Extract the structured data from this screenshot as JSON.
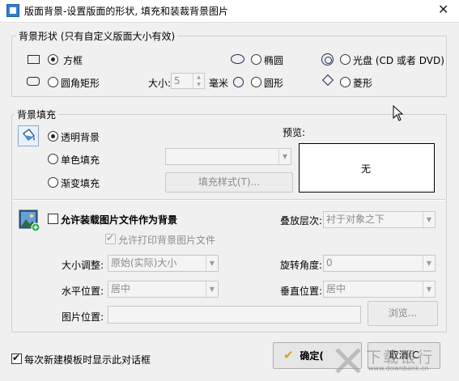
{
  "window": {
    "title": "版面背景-设置版面的形状, 填充和装裁背景图片",
    "close_glyph": "✕"
  },
  "shape_group": {
    "legend": "背景形状 (只有自定义版面大小有效)",
    "options": [
      {
        "label": "方框",
        "checked": true
      },
      {
        "label": "圆角矩形",
        "checked": false
      },
      {
        "label": "椭圆",
        "checked": false
      },
      {
        "label": "圆形",
        "checked": false
      },
      {
        "label": "光盘 (CD 或者 DVD)",
        "checked": false
      },
      {
        "label": "菱形",
        "checked": false
      }
    ],
    "size_label": "大小:",
    "size_value": "5",
    "size_unit": "毫米"
  },
  "fill_group": {
    "legend": "背景填充",
    "options": [
      {
        "label": "透明背景",
        "checked": true
      },
      {
        "label": "单色填充",
        "checked": false
      },
      {
        "label": "渐变填充",
        "checked": false
      }
    ],
    "color_value": "",
    "style_button": "填充样式(T)...",
    "preview_label": "预览:",
    "preview_text": "无"
  },
  "image_group": {
    "enable_label": "允许装载图片文件作为背景",
    "print_label": "允许打印背景图片文件",
    "layer_label": "叠放层次:",
    "layer_value": "衬于对象之下",
    "size_label": "大小调整:",
    "size_value": "原始(实际)大小",
    "rotate_label": "旋转角度:",
    "rotate_value": "0",
    "halign_label": "水平位置:",
    "halign_value": "居中",
    "valign_label": "垂直位置:",
    "valign_value": "居中",
    "path_label": "图片位置:",
    "path_value": "",
    "browse_button": "浏览..."
  },
  "footer": {
    "show_dialog_label": "每次新建模板时显示此对话框",
    "ok_label": "确定(",
    "cancel_label": "取消(C",
    "watermark_text": "下载银行",
    "watermark_url": "www.downbank.cn"
  },
  "colors": {
    "ok_check": "#d4a21a",
    "image_icon": "#2e5d8f",
    "add_badge": "#2fa84f"
  }
}
